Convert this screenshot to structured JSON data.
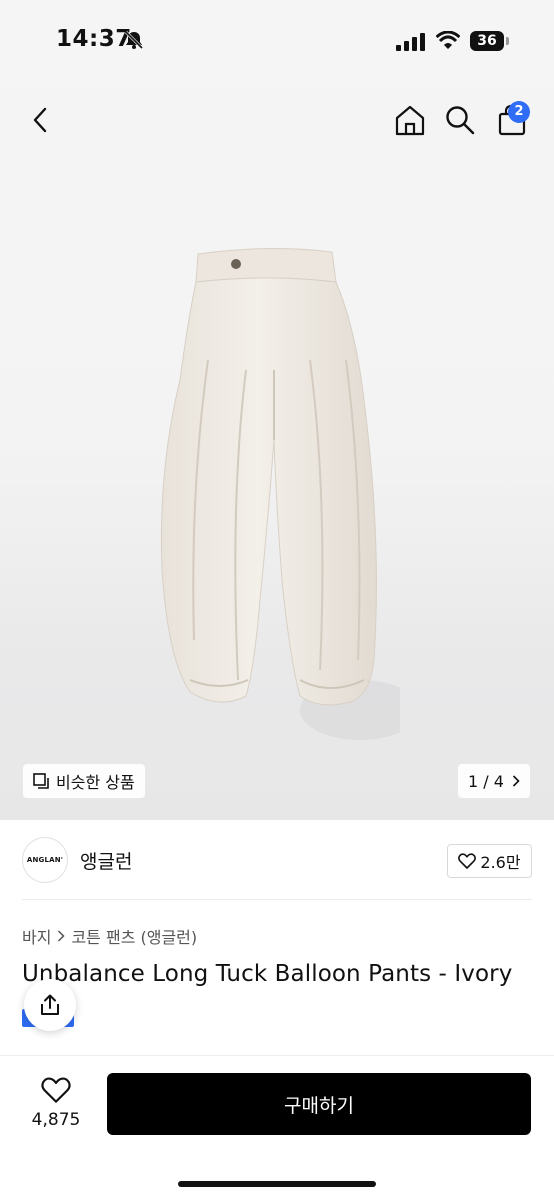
{
  "status_bar": {
    "time": "14:37",
    "battery": "36"
  },
  "nav": {
    "cart_count": "2"
  },
  "gallery": {
    "similar_label": "비슷한 상품",
    "page_indicator": "1 / 4"
  },
  "brand": {
    "logo_text": "ANGLAN'",
    "name": "앵글런",
    "likes": "2.6만"
  },
  "breadcrumb": {
    "category": "바지",
    "subcategory": "코튼 팬츠 (앵글런)"
  },
  "product": {
    "title": "Unbalance Long Tuck Balloon Pants - Ivory"
  },
  "bottom_bar": {
    "wish_count": "4,875",
    "buy_label": "구매하기"
  },
  "colors": {
    "accent": "#2f6df6",
    "buy_button": "#000000"
  }
}
